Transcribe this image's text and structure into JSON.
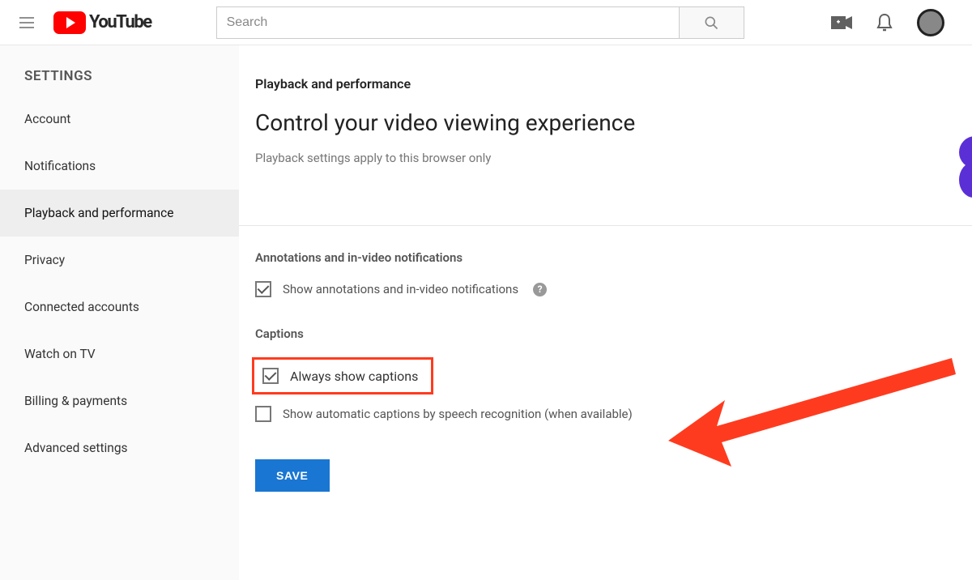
{
  "header": {
    "brand": "YouTube",
    "search_placeholder": "Search"
  },
  "sidebar": {
    "title": "SETTINGS",
    "items": [
      {
        "label": "Account",
        "active": false
      },
      {
        "label": "Notifications",
        "active": false
      },
      {
        "label": "Playback and performance",
        "active": true
      },
      {
        "label": "Privacy",
        "active": false
      },
      {
        "label": "Connected accounts",
        "active": false
      },
      {
        "label": "Watch on TV",
        "active": false
      },
      {
        "label": "Billing & payments",
        "active": false
      },
      {
        "label": "Advanced settings",
        "active": false
      }
    ]
  },
  "main": {
    "section_label": "Playback and performance",
    "title": "Control your video viewing experience",
    "subtitle": "Playback settings apply to this browser only",
    "annotations": {
      "group_title": "Annotations and in-video notifications",
      "checkbox_label": "Show annotations and in-video notifications",
      "checked": true
    },
    "captions": {
      "group_title": "Captions",
      "always_label": "Always show captions",
      "always_checked": true,
      "auto_label": "Show automatic captions by speech recognition (when available)",
      "auto_checked": false
    },
    "save_label": "SAVE"
  },
  "help_symbol": "?",
  "colors": {
    "highlight": "#ff3b1f",
    "primary_button": "#1976d2",
    "brand_red": "#ff0000"
  }
}
